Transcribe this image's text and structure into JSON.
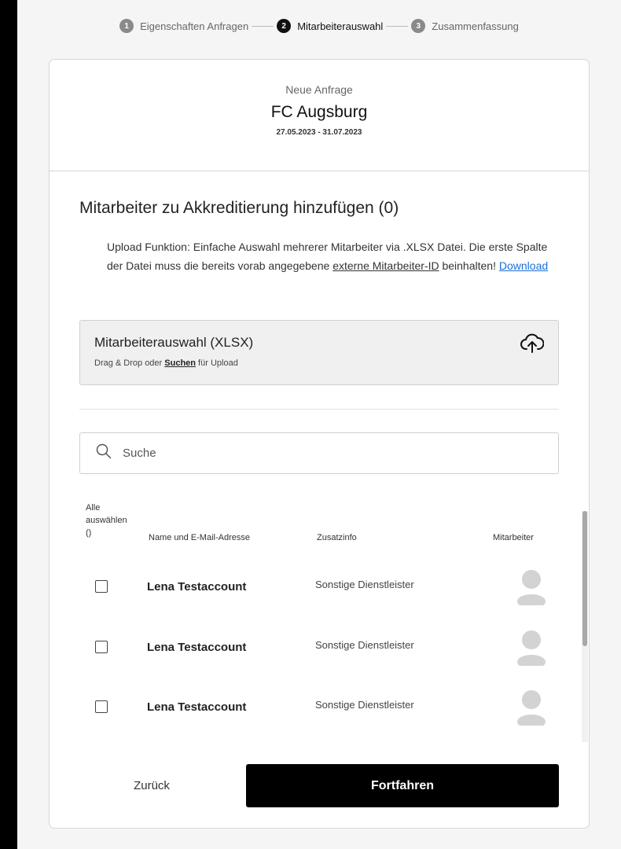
{
  "stepper": {
    "steps": [
      {
        "num": "1",
        "label": "Eigenschaften Anfragen"
      },
      {
        "num": "2",
        "label": "Mitarbeiterauswahl"
      },
      {
        "num": "3",
        "label": "Zusammenfassung"
      }
    ]
  },
  "header": {
    "subtitle": "Neue Anfrage",
    "title": "FC Augsburg",
    "dates": "27.05.2023 - 31.07.2023"
  },
  "section": {
    "title": "Mitarbeiter zu Akkreditierung hinzufügen (0)",
    "info_part1": "Upload Funktion: Einfache Auswahl mehrerer Mitarbeiter via .XLSX Datei. Die erste Spalte der Datei muss die bereits vorab angegebene ",
    "info_underlined": "externe Mitarbeiter-ID",
    "info_part2": " beinhalten! ",
    "info_link": "Download"
  },
  "upload": {
    "title": "Mitarbeiterauswahl (XLSX)",
    "hint_prefix": "Drag & Drop oder ",
    "hint_link": "Suchen",
    "hint_suffix": " für Upload",
    "icon": "cloud-upload-icon"
  },
  "search": {
    "placeholder": "Suche",
    "value": "",
    "icon": "search-icon"
  },
  "table": {
    "select_all_line1": "Alle",
    "select_all_line2": "auswählen",
    "select_all_line3": "()",
    "col_name": "Name und E-Mail-Adresse",
    "col_info": "Zusatzinfo",
    "col_employee": "Mitarbeiter",
    "rows": [
      {
        "name": "Lena Testaccount",
        "info": "Sonstige Dienstleister"
      },
      {
        "name": "Lena Testaccount",
        "info": "Sonstige Dienstleister"
      },
      {
        "name": "Lena Testaccount",
        "info": "Sonstige Dienstleister"
      }
    ]
  },
  "footer": {
    "back_label": "Zurück",
    "next_label": "Fortfahren"
  },
  "colors": {
    "primary_button": "#000000",
    "link": "#1a6fd6",
    "active_step": "#111111",
    "inactive_step": "#8a8a8a"
  }
}
